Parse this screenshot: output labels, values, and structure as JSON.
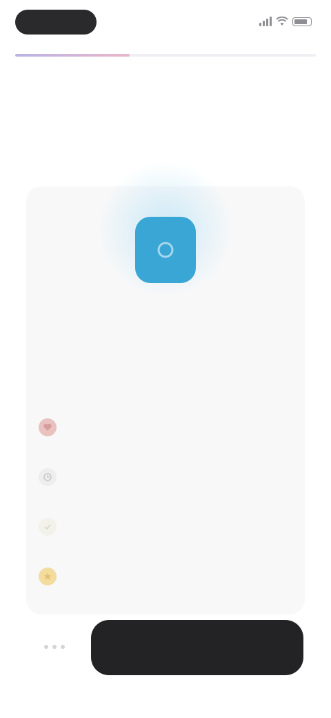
{
  "status_bar": {
    "time": "",
    "icons": [
      "signal-icon",
      "wifi-icon",
      "battery-icon"
    ]
  },
  "progress": {
    "fraction": 0.38
  },
  "header": {
    "title": "",
    "subtitle": ""
  },
  "plan": {
    "icon": "app-icon",
    "icon_color": "#3aa6d6",
    "name": "",
    "description": ""
  },
  "features": [
    {
      "icon": "heart-icon",
      "icon_color": "#e9c2c0",
      "label": "",
      "value": ""
    },
    {
      "icon": "clock-icon",
      "icon_color": "#eeeeee",
      "label": "",
      "value": ""
    },
    {
      "icon": "check-icon",
      "icon_color": "#f2f2ea",
      "label": "",
      "value": ""
    },
    {
      "icon": "star-icon",
      "icon_color": "#f3dc9e",
      "label": "",
      "value": ""
    }
  ],
  "cta": {
    "label": ""
  },
  "colors": {
    "background": "#ffffff",
    "card": "#f8f8f9",
    "button": "#232325",
    "accent": "#3aa6d6"
  }
}
